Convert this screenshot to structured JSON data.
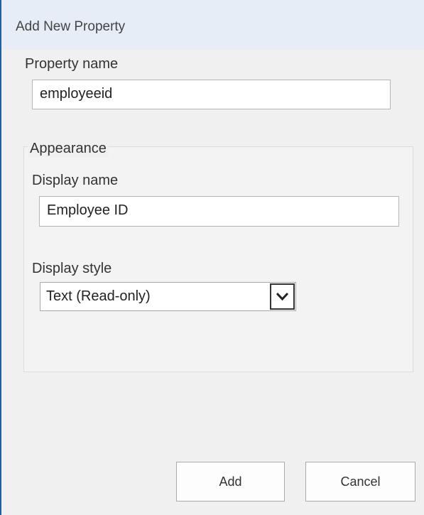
{
  "dialog": {
    "title": "Add New Property"
  },
  "property_name": {
    "label": "Property name",
    "value": "employeeid"
  },
  "appearance": {
    "legend": "Appearance",
    "display_name": {
      "label": "Display name",
      "value": "Employee ID"
    },
    "display_style": {
      "label": "Display style",
      "selected": "Text (Read-only)"
    }
  },
  "buttons": {
    "add_label": "Add",
    "cancel_label": "Cancel"
  },
  "icons": {
    "dropdown": "chevron-down-icon"
  }
}
